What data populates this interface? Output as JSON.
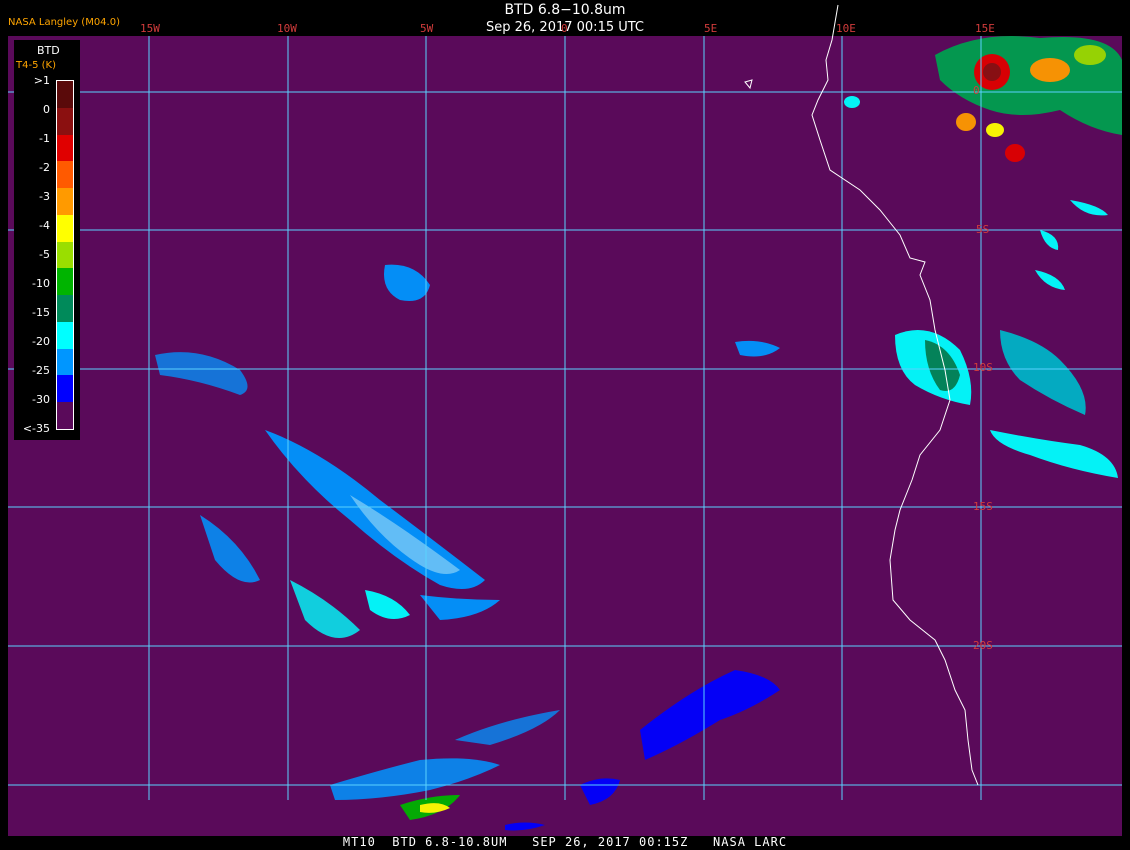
{
  "header": {
    "title": "BTD 6.8−10.8um",
    "datetime": "Sep 26, 2017 00:15 UTC",
    "org_label": "NASA Langley (M04.0)"
  },
  "legend": {
    "title": "BTD",
    "subtitle": "T4-5 (K)",
    "ticks": [
      ">1",
      "0",
      "-1",
      "-2",
      "-3",
      "-4",
      "-5",
      "-10",
      "-15",
      "-20",
      "-25",
      "-30",
      "<-35"
    ],
    "colors": [
      "#5a0a0a",
      "#8b1010",
      "#e00000",
      "#ff5a00",
      "#ff9a00",
      "#ffff00",
      "#9ade00",
      "#00b400",
      "#008a5a",
      "#00ffff",
      "#0096ff",
      "#0000ff",
      "#5a0a5a"
    ]
  },
  "grid": {
    "longitude_labels": [
      "15W",
      "10W",
      "5W",
      "0",
      "5E",
      "10E",
      "15E"
    ],
    "latitude_labels": [
      "0",
      "5S",
      "10S",
      "15S",
      "20S"
    ]
  },
  "colors": {
    "background": "#5a0a5a",
    "grid_line": "#5ad2ff",
    "coastline": "#ffffff",
    "label": "#d23c3c"
  },
  "footer": {
    "text": "MT10  BTD 6.8-10.8UM   SEP 26, 2017 00:15Z   NASA LARC"
  }
}
